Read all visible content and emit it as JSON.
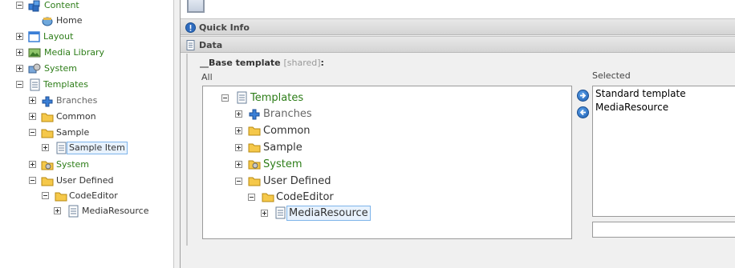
{
  "left_tree": {
    "items": [
      {
        "label": "Content"
      },
      {
        "label": "Home"
      },
      {
        "label": "Layout"
      },
      {
        "label": "Media Library"
      },
      {
        "label": "System"
      },
      {
        "label": "Templates"
      },
      {
        "label": "Branches"
      },
      {
        "label": "Common"
      },
      {
        "label": "Sample"
      },
      {
        "label": "Sample Item"
      },
      {
        "label": "System"
      },
      {
        "label": "User Defined"
      },
      {
        "label": "CodeEditor"
      },
      {
        "label": "MediaResource"
      }
    ]
  },
  "sections": {
    "quick_info": "Quick Info",
    "data": "Data"
  },
  "field": {
    "label": "__Base template",
    "shared_tag": "[shared]",
    "colon": ":"
  },
  "captions": {
    "all": "All",
    "selected": "Selected"
  },
  "template_tree": {
    "items": [
      {
        "label": "Templates"
      },
      {
        "label": "Branches"
      },
      {
        "label": "Common"
      },
      {
        "label": "Sample"
      },
      {
        "label": "System"
      },
      {
        "label": "User Defined"
      },
      {
        "label": "CodeEditor"
      },
      {
        "label": "MediaResource"
      }
    ]
  },
  "selected_list": [
    "Standard template",
    "MediaResource"
  ],
  "colors": {
    "green_label": "#2d7d18",
    "selection_border": "#7eb4ea",
    "arrow_blue": "#1f5fb0"
  },
  "icons": {
    "content": "content-cube-icon",
    "home": "home-page-icon",
    "layout": "layout-window-icon",
    "media": "media-picture-icon",
    "system": "system-gears-icon",
    "template": "template-doc-icon",
    "branch": "branch-puzzle-icon",
    "folder": "folder-icon",
    "quick_info": "info-icon",
    "add": "arrow-right-icon",
    "remove": "arrow-left-icon"
  }
}
